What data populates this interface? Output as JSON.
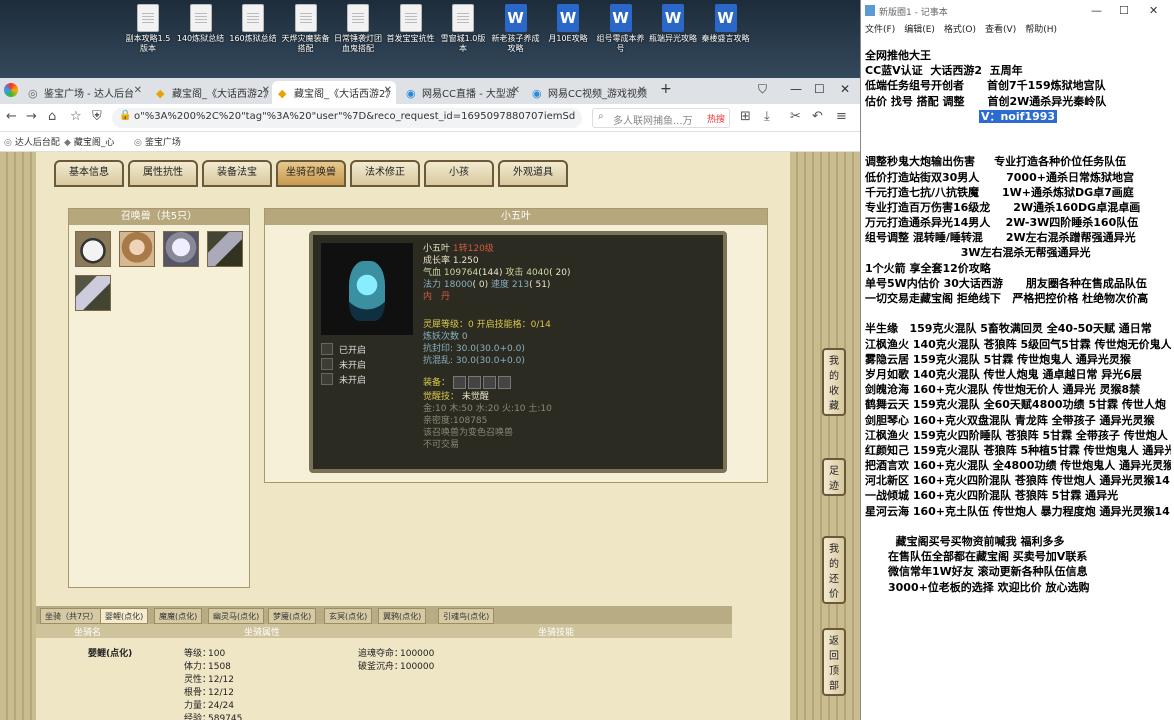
{
  "desktop": {
    "icons": [
      {
        "label": "副本攻略1.5版本",
        "type": "doc"
      },
      {
        "label": "140炼狱总结",
        "type": "doc"
      },
      {
        "label": "160炼狱总结",
        "type": "doc"
      },
      {
        "label": "天烨灾魔装备搭配",
        "type": "doc"
      },
      {
        "label": "日常锤袭灯团血鬼搭配",
        "type": "doc"
      },
      {
        "label": "首发宝宝抗性",
        "type": "doc"
      },
      {
        "label": "雪窗城1.0版本",
        "type": "doc"
      },
      {
        "label": "新老孩子养成攻略",
        "type": "word"
      },
      {
        "label": "月10E攻略",
        "type": "word"
      },
      {
        "label": "组号零成本养号",
        "type": "word"
      },
      {
        "label": "瓶端异光攻略",
        "type": "word"
      },
      {
        "label": "秦楼盛言攻略",
        "type": "word"
      }
    ]
  },
  "browser": {
    "tabs": [
      {
        "label": "鉴宝广场 - 达人后台",
        "active": false
      },
      {
        "label": "藏宝阁_《大话西游2》",
        "active": false
      },
      {
        "label": "藏宝阁_《大话西游2》",
        "active": true
      },
      {
        "label": "网易CC直播 - 大型游",
        "active": false
      },
      {
        "label": "网易CC视频_游戏视频",
        "active": false
      }
    ],
    "url": "o\"%3A%200%2C%20\"tag\"%3A%20\"user\"%7D&reco_request_id=1695097880707iemSd",
    "search_placeholder": "多人联网捕鱼...万",
    "search_hot": "热搜",
    "bookmarks": [
      "达人后台配",
      "藏宝阁_心",
      "鉴宝广场"
    ]
  },
  "game": {
    "tabs": [
      "基本信息",
      "属性抗性",
      "装备法宝",
      "坐骑召唤兽",
      "法术修正",
      "小孩",
      "外观道具"
    ],
    "active_tab": 3,
    "pets_title": "召唤兽（共5只）",
    "detail_title": "小五叶",
    "pet": {
      "name": "小五叶",
      "level": "1转120级",
      "growth": "成长率 1.250",
      "hp_label": "气血",
      "hp": "109764",
      "hp_extra": "(144)",
      "atk_label": "攻击",
      "atk": "4040",
      "atk_extra": "( 20)",
      "mp_label": "法力",
      "mp": "18000",
      "mp_extra": "( 0)",
      "spd_label": "速度",
      "spd": "213",
      "spd_extra": "( 51)",
      "element": "内　丹",
      "lingxi": "灵犀等级：0 开启技能格：0/14",
      "lianyao": "炼妖次数 0",
      "kangfeng": "抗封印: 30.0(30.0+0.0)",
      "kanghun": "抗混乱: 30.0(30.0+0.0)",
      "equip_label": "装备：",
      "awaken_label": "觉醒技：",
      "awaken_value": "未觉醒",
      "elements": "金:10 木:50 水:20 火:10 土:10",
      "pet_id": "亲密度:108785",
      "note1": "该召唤兽为变色召唤兽",
      "note2": "不可交易"
    },
    "skills": [
      "已开启",
      "未开启",
      "未开启"
    ],
    "bottom_tabs": [
      "坐骑（共7只）",
      "婴鲤(点化)",
      "魔魔(点化)",
      "幽灵马(点化)",
      "梦魇(点化)",
      "玄冥(点化)",
      "翼鸦(点化)",
      "引魂鸟(点化)"
    ],
    "bottom_header": [
      "坐骑名",
      "坐骑属性",
      "坐骑技能"
    ],
    "mount": {
      "name": "婴鲤(点化)",
      "stats": [
        {
          "label": "等级：",
          "value": "100"
        },
        {
          "label": "体力：",
          "value": "1508"
        },
        {
          "label": "灵性：",
          "value": "12/12"
        },
        {
          "label": "根骨：",
          "value": "12/12"
        },
        {
          "label": "力量：",
          "value": "24/24"
        },
        {
          "label": "经验：",
          "value": "589745"
        }
      ],
      "skills": [
        {
          "label": "追魂夺命：",
          "value": "100000"
        },
        {
          "label": "破釜沉舟：",
          "value": "100000"
        }
      ]
    },
    "side_buttons": [
      "我的收藏",
      "足迹",
      "我的还价",
      "返回顶部"
    ]
  },
  "notepad": {
    "title": "新版圈1 - 记事本",
    "menu": [
      "文件(F)",
      "编辑(E)",
      "格式(O)",
      "查看(V)",
      "帮助(H)"
    ],
    "lines": [
      "全网推他大王",
      "CC蓝V认证  大话西游2  五周年",
      "低端任务组号开创者      首创7千159炼狱地宫队",
      "估价 找号 搭配 调整      首创2W通杀异光秦岭队",
      "",
      "",
      "调整秒鬼大炮输出伤害     专业打造各种价位任务队伍",
      "低价打造站街双30男人       7000+通杀日常炼狱地宫",
      "千元打造七抗/八抗铁魔      1W+通杀炼狱DG卓7画庭",
      "专业打造百万伤害16级龙      2W通杀160DG卓混卓画",
      "万元打造通杀异光14男人    2W-3W四阶睡杀160队伍",
      "组号调整 混转睡/睡转混      2W左右混杀蹭帮强通异光",
      "                         3W左右混杀无帮强通异光",
      "1个火箭 享全套12价攻略",
      "单号5W内估价 30大话西游      朋友圈各种在售成品队伍",
      "一切交易走藏宝阁 拒绝线下   严格把控价格 杜绝物次价高",
      "",
      "半生缘   159克火混队 5畜牧满回灵 全40-50天赋 通日常",
      "江枫渔火 140克火混队 苍狼阵 5级回气5甘霖 传世炮无价鬼人",
      "雾隐云居 159克火混队 5甘霖 传世炮鬼人 通异光灵猴",
      "岁月如歌 140克火混队 传世人炮鬼 通卓越日常 异光6层",
      "剑魄沧海 160+克火混队 传世炮无价人 通异光 灵猴8禁",
      "鹤舞云天 159克火混队 全60天赋4800功绩 5甘霖 传世人炮",
      "剑胆琴心 160+克火双盘混队 青龙阵 全带孩子 通异光灵猴",
      "江枫渔火 159克火四阶睡队 苍狼阵 5甘霖 全带孩子 传世炮人",
      "红颜知己 159克火混队 苍狼阵 5种植5甘霖 传世炮鬼人 通异光",
      "把酒言欢 160+克火混队 全4800功绩 传世炮鬼人 通异光灵猴",
      "河北新区 160+克火四阶混队 苍狼阵 传世炮人 通异光灵猴14",
      "一战倾城 160+克火四阶混队 苍狼阵 5甘霖 通异光",
      "星河云海 160+克土队伍 传世炮人 暴力程度炮 通异光灵猴14",
      "",
      "        藏宝阁买号买物资前喊我 福利多多",
      "      在售队伍全部都在藏宝阁 买卖号加V联系",
      "      微信常年1W好友 滚动更新各种队伍信息",
      "      3000+位老板的选择 欢迎比价 放心选购"
    ],
    "highlight": "V：noif1993",
    "highlight_after_line": 3
  }
}
